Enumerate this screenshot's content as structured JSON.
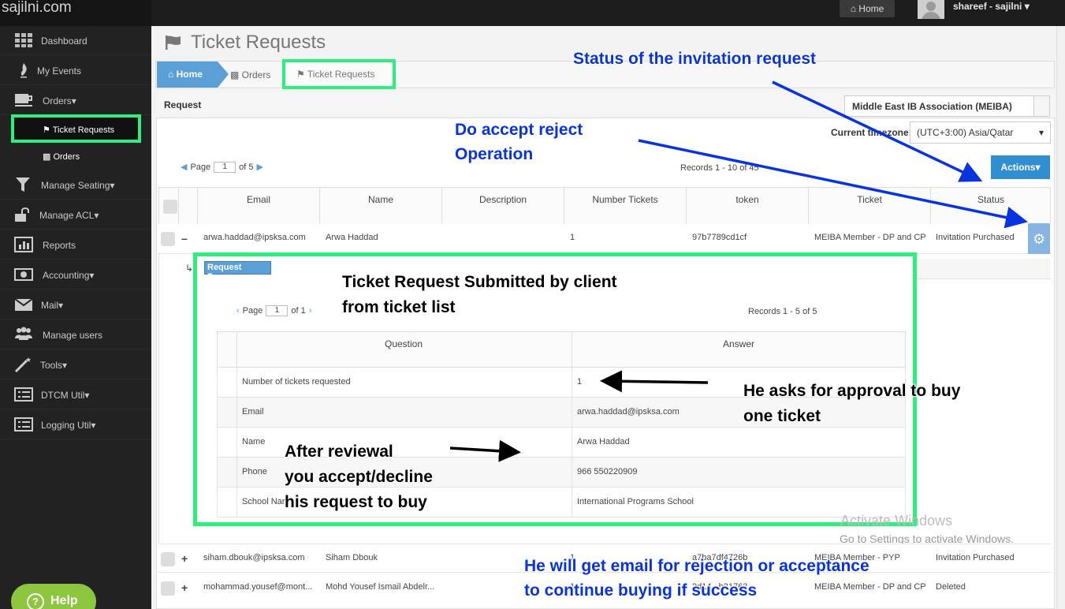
{
  "app": {
    "brand": "sajilni.com",
    "home_label": "Home",
    "user": "shareef - sajilni"
  },
  "sidebar": {
    "items": [
      {
        "label": "Dashboard"
      },
      {
        "label": "My Events"
      },
      {
        "label": "Orders"
      },
      {
        "label": "Ticket Requests"
      },
      {
        "label": "Orders"
      },
      {
        "label": "Manage Seating"
      },
      {
        "label": "Manage ACL"
      },
      {
        "label": "Reports"
      },
      {
        "label": "Accounting"
      },
      {
        "label": "Mail"
      },
      {
        "label": "Manage users"
      },
      {
        "label": "Tools"
      },
      {
        "label": "DTCM Util"
      },
      {
        "label": "Logging Util"
      }
    ],
    "help": "Help"
  },
  "page": {
    "title": "Ticket Requests",
    "breadcrumb": {
      "home": "Home",
      "orders": "Orders",
      "current": "Ticket Requests"
    },
    "panel_label": "Request",
    "organization": "Middle East IB Association (MEIBA)",
    "timezone_label": "Current timezone:",
    "timezone": "(UTC+3:00) Asia/Qatar",
    "actions": "Actions"
  },
  "grid": {
    "pager": {
      "page_label": "Page",
      "page": "1",
      "of_label": "of 5"
    },
    "records": "Records 1 - 10 of 45",
    "columns": [
      "Email",
      "Name",
      "Description",
      "Number Tickets",
      "token",
      "Ticket",
      "Status"
    ],
    "rows": [
      {
        "toggle": "–",
        "email": "arwa.haddad@ipsksa.com",
        "name": "Arwa Haddad",
        "description": "",
        "tickets": "1",
        "token": "97b7789cd1cf",
        "ticket": "MEIBA Member - DP and CP",
        "status": "Invitation Purchased"
      },
      {
        "toggle": "+",
        "email": "siham.dbouk@ipsksa.com",
        "name": "Siham Dbouk",
        "description": "",
        "tickets": "1",
        "token": "a7ba7df4726b",
        "ticket": "MEIBA Member - PYP",
        "status": "Invitation Purchased"
      },
      {
        "toggle": "+",
        "email": "mohammad.yousef@mont...",
        "name": "Mohd Yousef Ismail Abdelr...",
        "description": "",
        "tickets": "1",
        "token": "2d14...b31763",
        "ticket": "MEIBA Member - DP and CP",
        "status": "Deleted"
      }
    ]
  },
  "subgrid": {
    "tag": "Request Form:",
    "pager": {
      "page_label": "Page",
      "page": "1",
      "of_label": "of 1"
    },
    "records": "Records 1 - 5 of 5",
    "columns": [
      "Question",
      "Answer"
    ],
    "rows": [
      {
        "question": "Number of tickets requested",
        "answer": "1"
      },
      {
        "question": "Email",
        "answer": "arwa.haddad@ipsksa.com"
      },
      {
        "question": "Name",
        "answer": "Arwa Haddad"
      },
      {
        "question": "Phone",
        "answer": "966 550220909"
      },
      {
        "question": "School Nar",
        "answer": "International Programs School"
      }
    ]
  },
  "annotations": {
    "status": "Status of the invitation request",
    "accept_1": "Do accept reject",
    "accept_2": "Operation",
    "submitted_1": "Ticket Request Submitted by client",
    "submitted_2": "from ticket list",
    "approval_1": "He asks for approval to buy",
    "approval_2": "one ticket",
    "review_1": "After reviewal",
    "review_2": "you accept/decline",
    "review_3": "his request to buy",
    "email_1": "He will get email for rejection or acceptance",
    "email_2": "to continue buying if success"
  },
  "watermark": {
    "line1": "Activate Windows",
    "line2": "Go to Settings to activate Windows."
  },
  "colors": {
    "highlight": "#2bf07e",
    "annotation_blue": "#0a33e0",
    "accent": "#5a9fd6"
  }
}
